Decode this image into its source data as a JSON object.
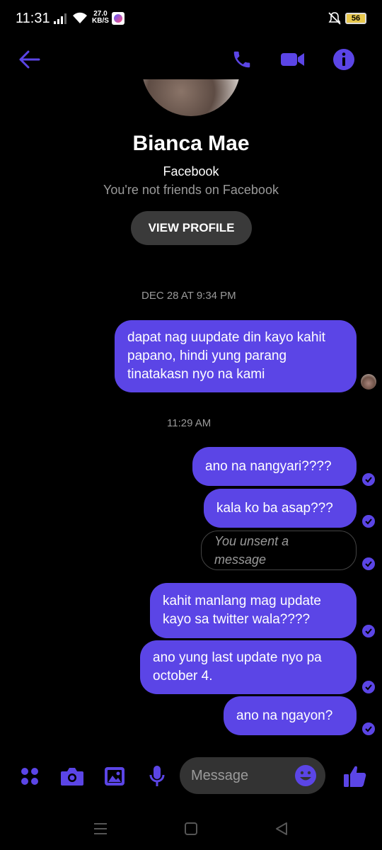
{
  "status_bar": {
    "time": "11:31",
    "speed_value": "27.0",
    "speed_unit": "KB/S",
    "battery": "56"
  },
  "header": {
    "back_icon": "back-arrow-icon",
    "call_icon": "phone-icon",
    "video_icon": "video-camera-icon",
    "info_icon": "info-icon",
    "accent_color": "#5b45e6"
  },
  "profile": {
    "name": "Bianca Mae",
    "network": "Facebook",
    "relationship": "You're not friends on Facebook",
    "view_profile_label": "VIEW PROFILE"
  },
  "conversation": {
    "timestamps": [
      "DEC 28 AT 9:34 PM",
      "11:29 AM"
    ],
    "messages": [
      {
        "text": "dapat nag uupdate din kayo kahit papano, hindi yung parang tinatakasn nyo na kami",
        "sender": "me",
        "status": "seen"
      },
      {
        "text": "ano na nangyari????",
        "sender": "me",
        "status": "delivered"
      },
      {
        "text": "kala ko ba asap???",
        "sender": "me",
        "status": "delivered"
      },
      {
        "text": "You unsent a message",
        "sender": "me",
        "status": "delivered",
        "unsent": true
      },
      {
        "text": "kahit manlang mag update kayo sa twitter wala????",
        "sender": "me",
        "status": "delivered"
      },
      {
        "text": "ano yung last update nyo pa october 4.",
        "sender": "me",
        "status": "delivered"
      },
      {
        "text": "ano na ngayon?",
        "sender": "me",
        "status": "delivered"
      }
    ]
  },
  "composer": {
    "placeholder": "Message",
    "icons": [
      "apps-icon",
      "camera-icon",
      "gallery-icon",
      "microphone-icon",
      "emoji-icon",
      "thumbs-up-icon"
    ]
  },
  "navigation": {
    "icons": [
      "recent-apps-icon",
      "home-icon",
      "back-icon"
    ]
  }
}
